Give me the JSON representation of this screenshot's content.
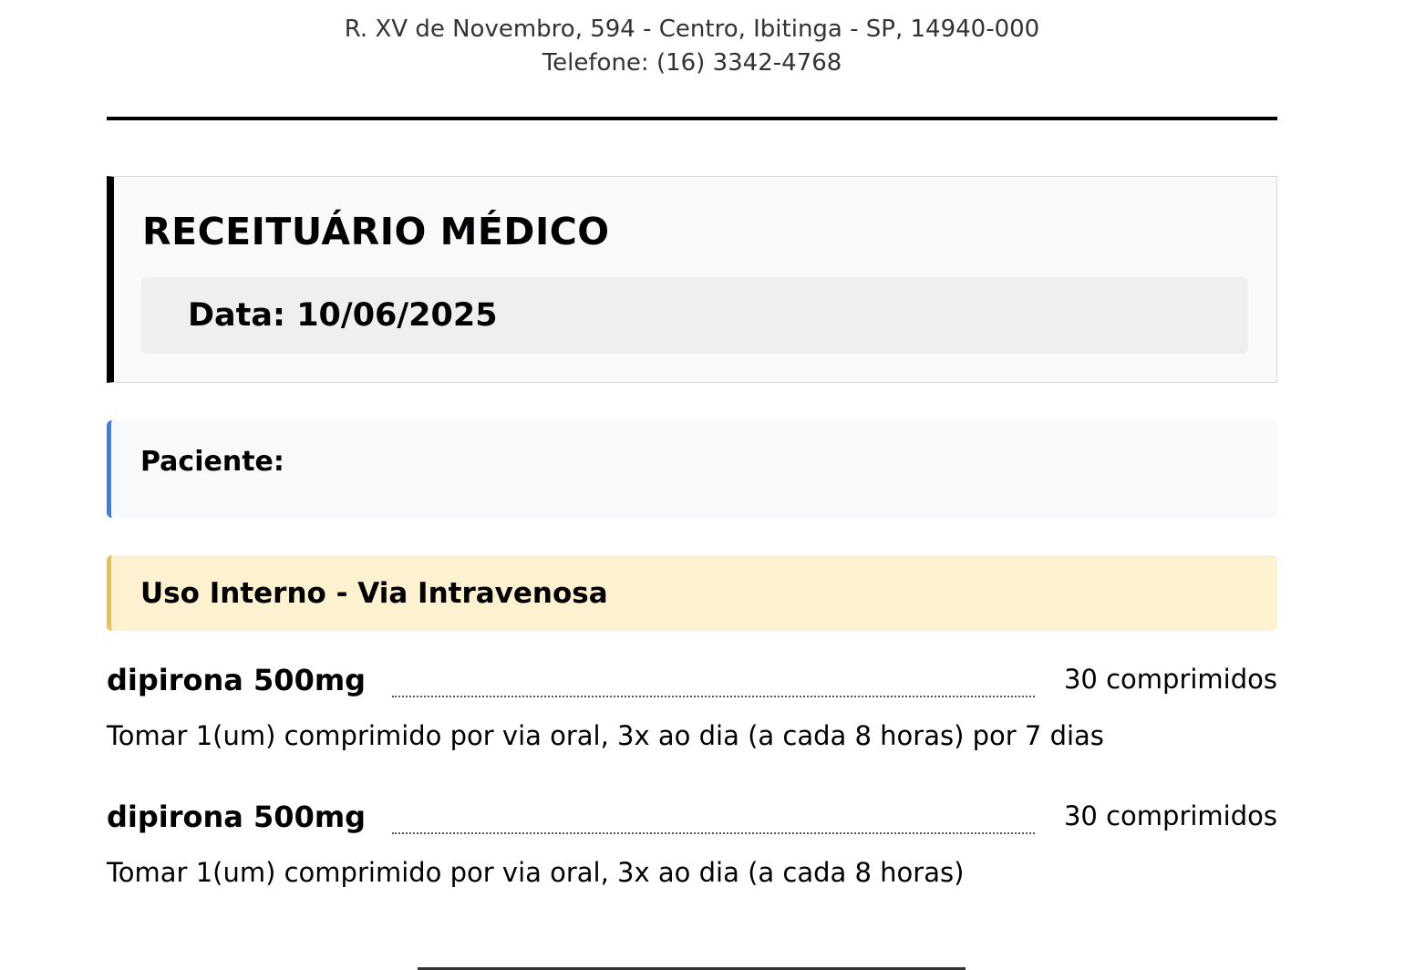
{
  "header": {
    "address": "R. XV de Novembro, 594 - Centro, Ibitinga - SP, 14940-000",
    "phone": "Telefone: (16) 3342-4768"
  },
  "document": {
    "title": "RECEITUÁRIO MÉDICO",
    "date": "Data: 10/06/2025"
  },
  "patient": {
    "label": "Paciente:"
  },
  "usage": {
    "label": "Uso Interno - Via Intravenosa"
  },
  "medications": [
    {
      "name": "dipirona 500mg",
      "quantity": "30 comprimidos",
      "instructions": "Tomar 1(um) comprimido por via oral, 3x ao dia (a cada 8 horas) por 7 dias"
    },
    {
      "name": "dipirona 500mg",
      "quantity": "30 comprimidos",
      "instructions": "Tomar 1(um) comprimido por via oral, 3x ao dia (a cada 8 horas)"
    }
  ],
  "colors": {
    "patient_accent": "#3b7de0",
    "usage_accent": "#ecc04e",
    "usage_background": "#fdf2cf"
  }
}
